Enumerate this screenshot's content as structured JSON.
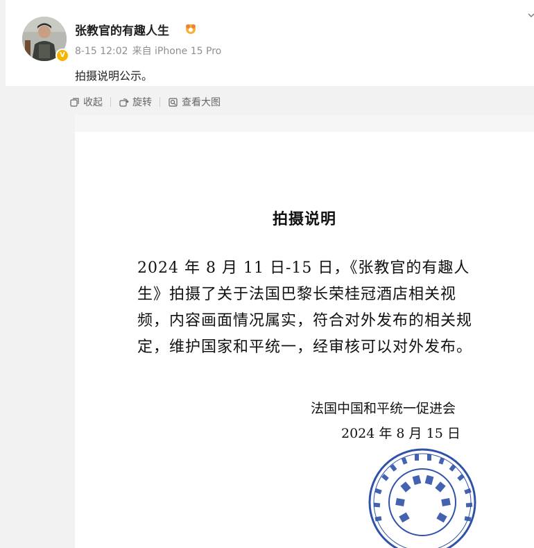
{
  "post": {
    "username": "张教官的有趣人生",
    "time": "8-15 12:02",
    "source": "来自 iPhone 15 Pro",
    "text": "拍摄说明公示。"
  },
  "toolbar": {
    "collapse": "收起",
    "rotate": "旋转",
    "view_large": "查看大图"
  },
  "document": {
    "title": "拍摄说明",
    "body": "2024 年 8 月 11 日-15 日，《张教官的有趣人生》拍摄了关于法国巴黎长荣桂冠酒店相关视频，内容画面情况属实，符合对外发布的相关规定，维护国家和平统一，经审核可以对外发布。",
    "signature_org": "法国中国和平统一促进会",
    "signature_date": "2024 年 8 月 15 日"
  },
  "colors": {
    "verified_badge": "#f7b500",
    "seal_blue": "#2f52a8"
  },
  "icons": {
    "collapse": "collapse-icon",
    "rotate": "rotate-icon",
    "view_large": "view-large-icon",
    "verified": "verified-v-badge-icon",
    "user_badge": "flower-badge-icon",
    "menu": "chevron-down-icon"
  }
}
